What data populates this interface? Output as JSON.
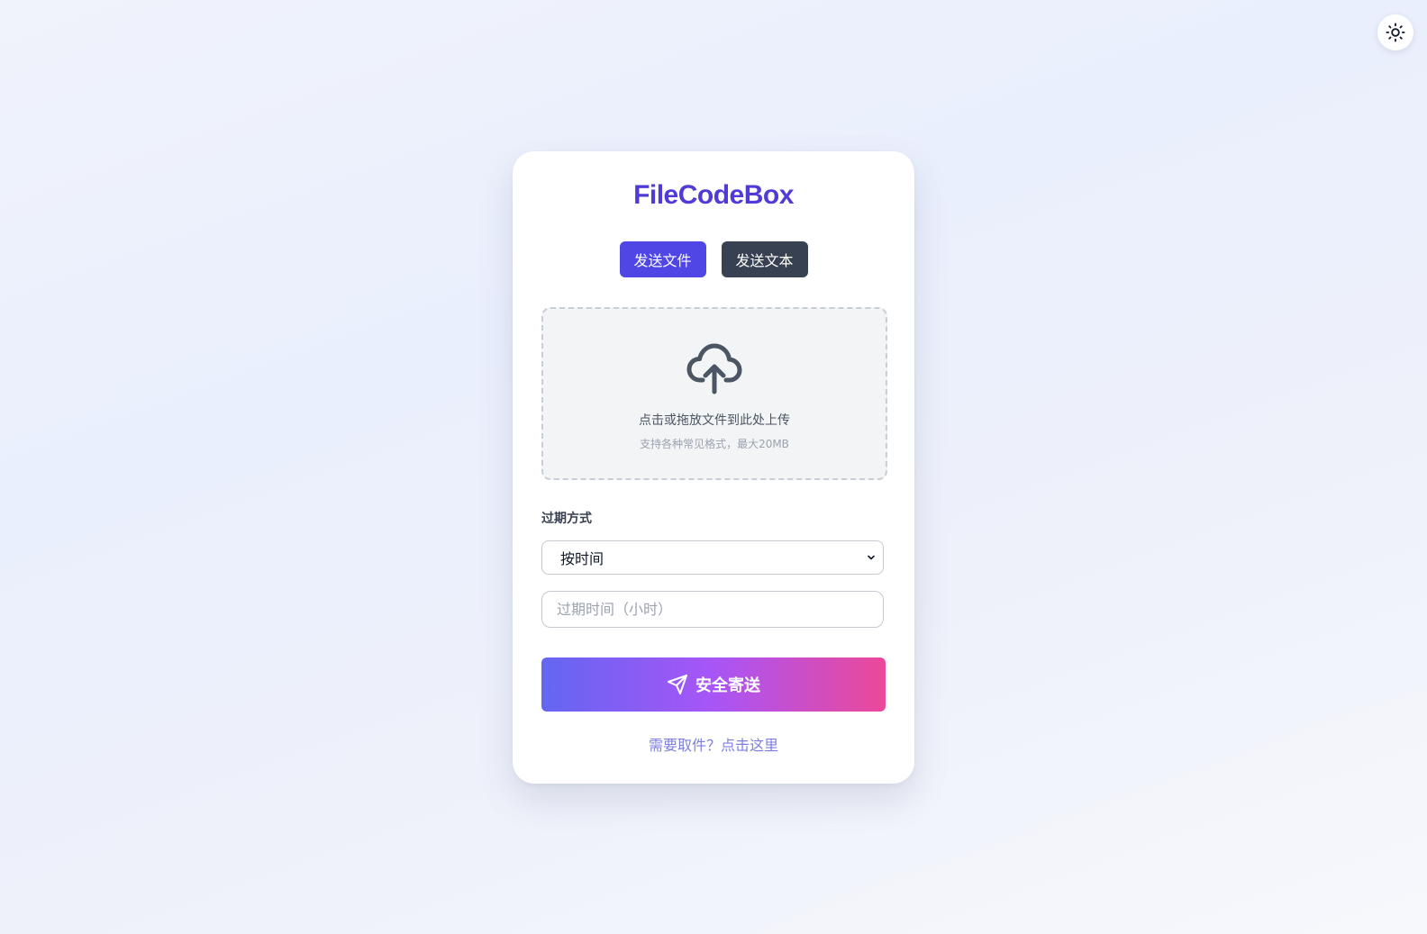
{
  "theme_toggle": {
    "icon": "sun-icon"
  },
  "app": {
    "title": "FileCodeBox"
  },
  "tabs": [
    {
      "label": "发送文件",
      "active": true
    },
    {
      "label": "发送文本",
      "active": false
    }
  ],
  "upload": {
    "icon": "cloud-upload-icon",
    "main_text": "点击或拖放文件到此处上传",
    "sub_text": "支持各种常见格式，最大20MB"
  },
  "expire": {
    "label": "过期方式",
    "method_value": "按时间",
    "time_placeholder": "过期时间（小时）"
  },
  "send_button": {
    "icon": "paper-plane-icon",
    "label": "安全寄送"
  },
  "retrieve_link": {
    "label": "需要取件？点击这里"
  },
  "colors": {
    "brand": "#4f3bd6",
    "tab_active": "#4f46e5",
    "tab_inactive": "#374151",
    "gradient_start": "#6366f1",
    "gradient_mid": "#a855f7",
    "gradient_end": "#ec4899",
    "link": "#7c7fe0"
  }
}
